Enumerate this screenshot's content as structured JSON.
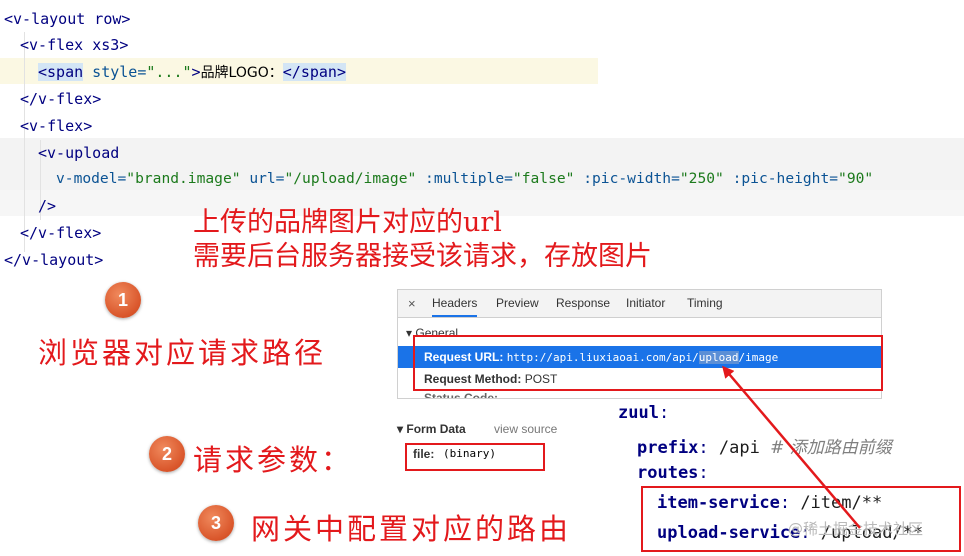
{
  "code": {
    "lines": [
      {
        "a": "<v-layout row>"
      },
      {
        "a": "<v-flex xs3>"
      },
      {
        "a": "<span",
        "b": " style=",
        "c": "\"...\"",
        "d": ">",
        "e": "品牌LOGO：",
        "f": "</span>"
      },
      {
        "a": "</v-flex>"
      },
      {
        "a": "<v-flex>"
      },
      {
        "a": "<v-upload"
      },
      {
        "a": "v-model=",
        "b": "\"brand.image\"",
        "c": " url=",
        "d": "\"/upload/image\"",
        "e": " :multiple=",
        "f": "\"false\"",
        "g": " :pic-width=",
        "h": "\"250\"",
        "i": " :pic-height=",
        "j": "\"90\""
      },
      {
        "a": "/>"
      },
      {
        "a": "</v-flex>"
      },
      {
        "a": "</v-layout>"
      }
    ]
  },
  "annotation": {
    "line1": "上传的品牌图片对应的url",
    "line2": "需要后台服务器接受该请求，存放图片"
  },
  "steps": [
    {
      "num": "1",
      "label": "浏览器对应请求路径"
    },
    {
      "num": "2",
      "label": "请求参数："
    },
    {
      "num": "3",
      "label": "网关中配置对应的路由"
    }
  ],
  "devtools": {
    "close": "×",
    "tabs": [
      "Headers",
      "Preview",
      "Response",
      "Initiator",
      "Timing"
    ],
    "active_tab": "Headers",
    "section": "▾ General",
    "request_url_label": "Request URL:",
    "request_url_pre": "http://api.liuxiaoai.com/api/",
    "request_url_hl": "upload",
    "request_url_post": "/image",
    "request_method_label": "Request Method:",
    "request_method_value": "POST",
    "status_code_label": "Status Code:"
  },
  "form_data": {
    "title": "▾ Form Data",
    "view_source": "view source",
    "key": "file:",
    "value": "(binary)"
  },
  "zuul": {
    "root": "zuul",
    "prefix_key": "prefix",
    "prefix_value": "/api",
    "prefix_comment": "# 添加路由前缀",
    "routes_key": "routes",
    "route1_key": "item-service",
    "route1_value": "/item/**",
    "route2_key": "upload-service",
    "route2_value": "/upload/**"
  },
  "watermark": "@稀土掘金技术社区",
  "colors": {
    "annotation_red": "#e3191c",
    "devtools_selected": "#1a73e8"
  }
}
